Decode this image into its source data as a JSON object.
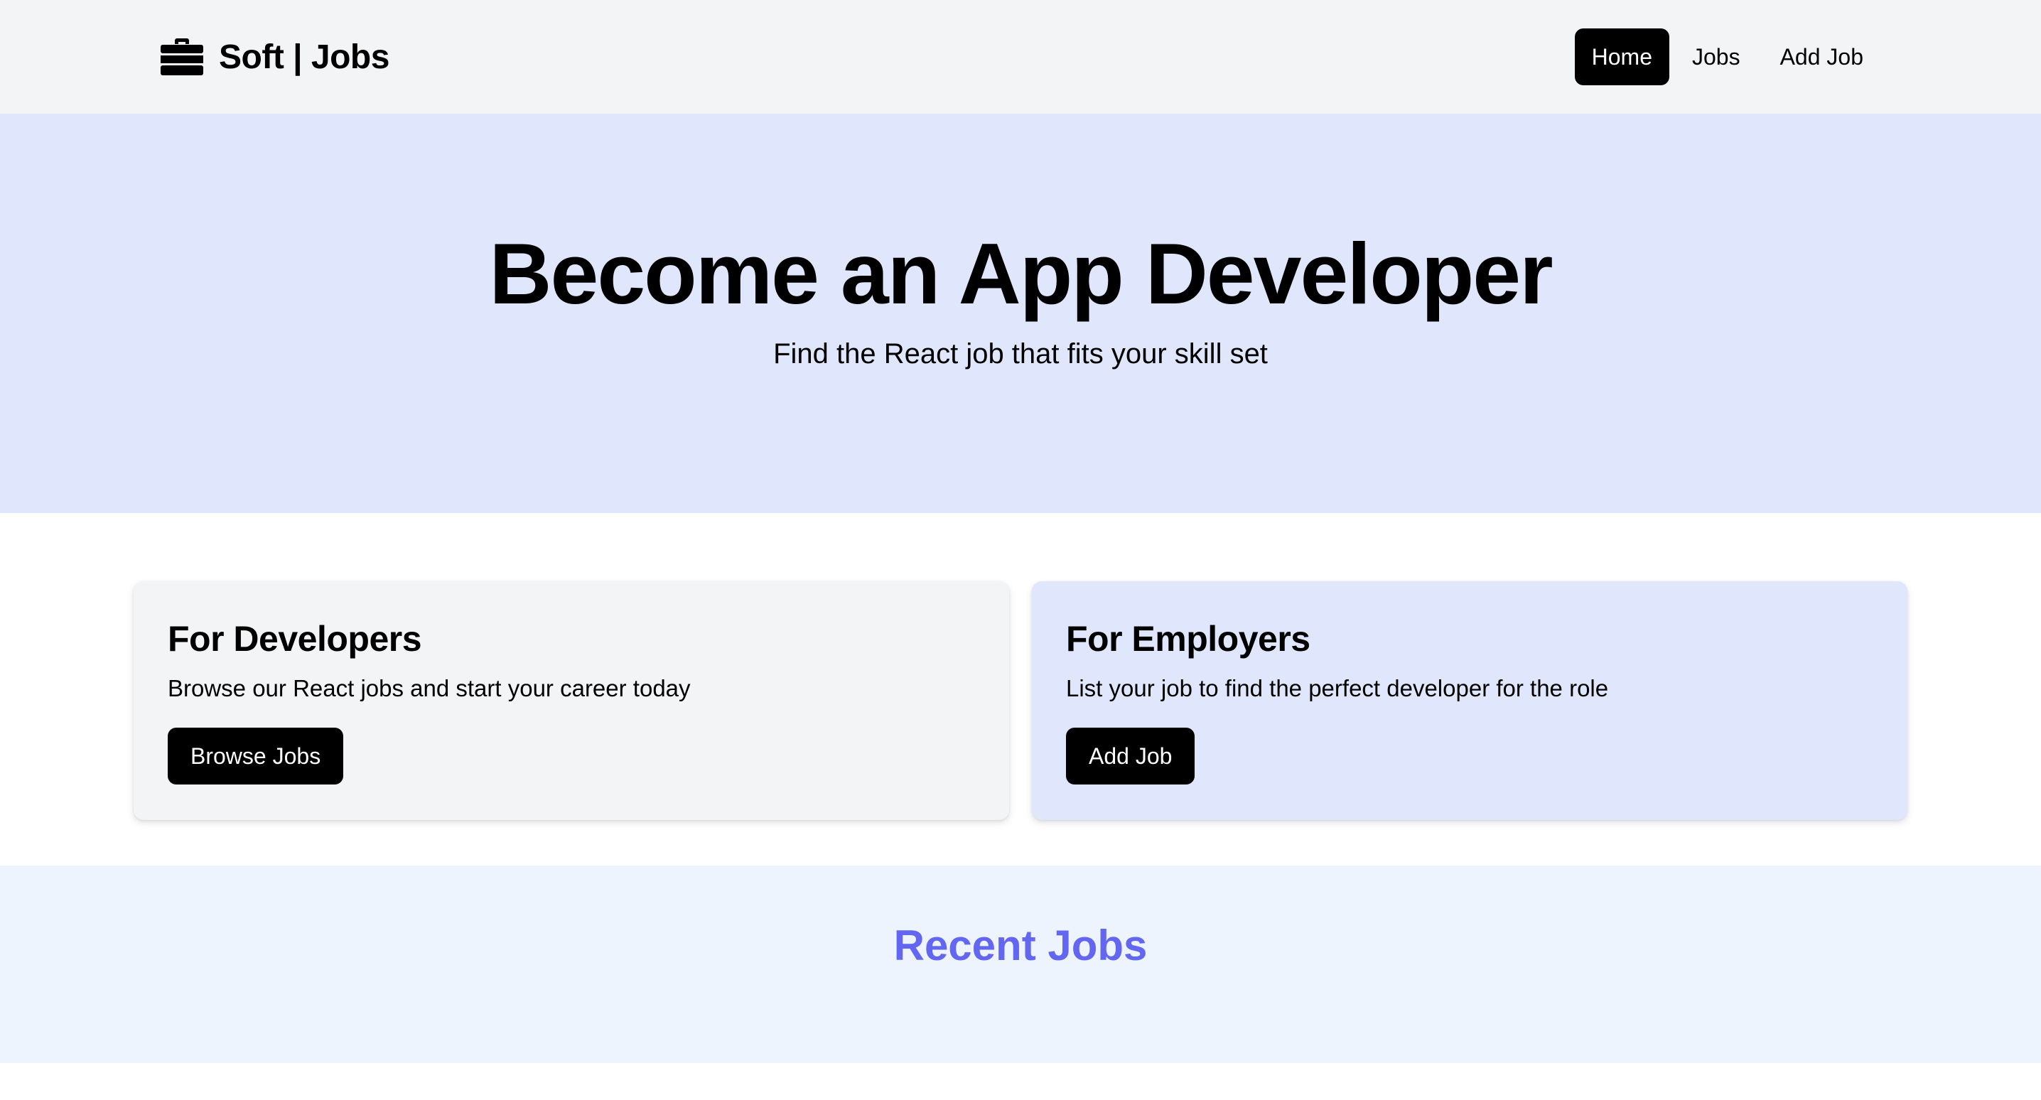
{
  "navbar": {
    "brand_icon": "briefcase-icon",
    "brand_text": "Soft | Jobs",
    "links": [
      {
        "label": "Home",
        "active": true
      },
      {
        "label": "Jobs",
        "active": false
      },
      {
        "label": "Add Job",
        "active": false
      }
    ]
  },
  "hero": {
    "title": "Become an App Developer",
    "subtitle": "Find the React job that fits your skill set"
  },
  "cards": {
    "developers": {
      "title": "For Developers",
      "text": "Browse our React jobs and start your career today",
      "button": "Browse Jobs"
    },
    "employers": {
      "title": "For Employers",
      "text": "List your job to find the perfect developer for the role",
      "button": "Add Job"
    }
  },
  "recent_jobs": {
    "title": "Recent Jobs"
  },
  "colors": {
    "navbar_bg": "#f3f4f6",
    "hero_bg": "#e0e7fc",
    "recent_bg": "#eef4fe",
    "accent": "#6366f1",
    "button_bg": "#000000"
  }
}
